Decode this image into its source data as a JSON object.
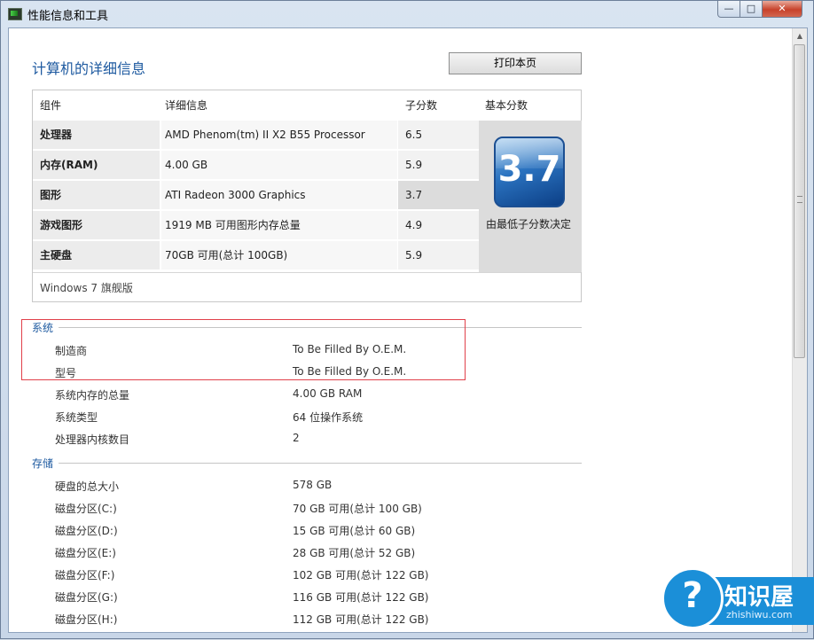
{
  "window": {
    "title": "性能信息和工具",
    "minimize_glyph": "—",
    "maximize_glyph": "□",
    "close_glyph": "✕"
  },
  "page": {
    "title": "计算机的详细信息",
    "print_button": "打印本页"
  },
  "score_table": {
    "headers": {
      "component": "组件",
      "details": "详细信息",
      "subscore": "子分数",
      "base_score": "基本分数"
    },
    "rows": [
      {
        "component": "处理器",
        "details": "AMD Phenom(tm) II X2 B55 Processor",
        "subscore": "6.5"
      },
      {
        "component": "内存(RAM)",
        "details": "4.00 GB",
        "subscore": "5.9"
      },
      {
        "component": "图形",
        "details": "ATI Radeon 3000 Graphics",
        "subscore": "3.7"
      },
      {
        "component": "游戏图形",
        "details": "1919 MB 可用图形内存总量",
        "subscore": "4.9"
      },
      {
        "component": "主硬盘",
        "details": "70GB 可用(总计 100GB)",
        "subscore": "5.9"
      }
    ],
    "base_score": "3.7",
    "base_note": "由最低子分数决定",
    "edition": "Windows 7 旗舰版"
  },
  "system": {
    "title": "系统",
    "items": [
      {
        "label": "制造商",
        "value": "To Be Filled By O.E.M."
      },
      {
        "label": "型号",
        "value": "To Be Filled By O.E.M."
      },
      {
        "label": "系统内存的总量",
        "value": "4.00 GB RAM"
      },
      {
        "label": "系统类型",
        "value": "64 位操作系统"
      },
      {
        "label": "处理器内核数目",
        "value": "2"
      }
    ]
  },
  "storage": {
    "title": "存储",
    "items": [
      {
        "label": "硬盘的总大小",
        "value": "578 GB"
      },
      {
        "label": "磁盘分区(C:)",
        "value": "70 GB 可用(总计 100 GB)"
      },
      {
        "label": "磁盘分区(D:)",
        "value": "15 GB 可用(总计 60 GB)"
      },
      {
        "label": "磁盘分区(E:)",
        "value": "28 GB 可用(总计 52 GB)"
      },
      {
        "label": "磁盘分区(F:)",
        "value": "102 GB 可用(总计 122 GB)"
      },
      {
        "label": "磁盘分区(G:)",
        "value": "116 GB 可用(总计 122 GB)"
      },
      {
        "label": "磁盘分区(H:)",
        "value": "112 GB 可用(总计 122 GB)"
      }
    ]
  },
  "watermark": {
    "text": "知识屋",
    "domain": "zhishiwu.com"
  },
  "colors": {
    "accent_text": "#1e5aa0",
    "highlight_border": "#e0404a",
    "watermark_blue": "#1b8fd8"
  }
}
